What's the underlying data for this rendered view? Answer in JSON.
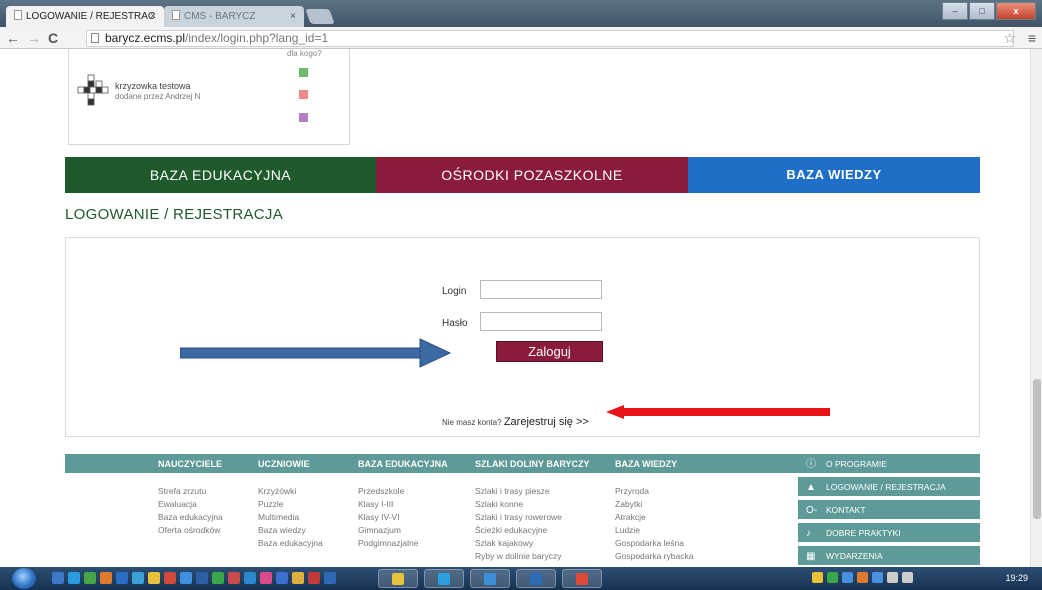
{
  "browser": {
    "tabs": [
      {
        "label": "LOGOWANIE / REJESTRAC",
        "close": "×"
      },
      {
        "label": "CMS - BARYCZ",
        "close": "×"
      }
    ],
    "window_buttons": {
      "min": "–",
      "max": "□",
      "close": "x"
    },
    "url_host": "barycz.ecms.pl",
    "url_path": "/index/login.php?lang_id=1",
    "back": "←",
    "forward": "→",
    "reload": "C",
    "star": "☆",
    "menu": "≡"
  },
  "widget": {
    "caption": "dla kogo?",
    "title": "krzyzowka testowa",
    "byline": "dodane przez Andrzej N",
    "audience_colors": [
      "#6dbb6d",
      "#ef8a8a",
      "#b07fc4"
    ]
  },
  "categories": [
    {
      "label": "Baza edukacyjna",
      "color": "#1f5a2c"
    },
    {
      "label": "Ośrodki pozaszkolne",
      "color": "#8a1b3a"
    },
    {
      "label": "BAZA WIEDZY",
      "color": "#1f6ec7"
    }
  ],
  "page_title": "LOGOWANIE / REJESTRACJA",
  "login_form": {
    "login_label": "Login",
    "password_label": "Hasło",
    "login_value": "",
    "password_value": "",
    "submit_label": "Zaloguj",
    "no_account_text": "Nie masz konta?",
    "register_link": "Zarejestruj się >>"
  },
  "footer": {
    "columns": [
      {
        "header": "NAUCZYCIELE",
        "items": [
          "Strefa zrzutu",
          "Ewaluacja",
          "Baza edukacyjna",
          "Oferta ośrodków"
        ]
      },
      {
        "header": "UCZNIOWIE",
        "items": [
          "Krzyżówki",
          "Puzzle",
          "Multimedia",
          "Baza wiedzy",
          "Baza edukacyjna"
        ]
      },
      {
        "header": "BAZA EDUKACYJNA",
        "items": [
          "Przedszkole",
          "Klasy I-III",
          "Klasy IV-VI",
          "Gimnazjum",
          "Podgimnazjalne"
        ]
      },
      {
        "header": "SZLAKI DOLINY BARYCZY",
        "items": [
          "Szlaki i trasy piesze",
          "Szlaki konne",
          "Szlaki i trasy rowerowe",
          "Ścieżki edukacyjne",
          "Szlak kajakowy",
          "Ryby w dolinie baryczy"
        ]
      },
      {
        "header": "BAZA WIEDZY",
        "items": [
          "Przyroda",
          "Zabytki",
          "Atrakcje",
          "Ludzie",
          "Gospodarka leśna",
          "Gospodarka rybacka"
        ]
      }
    ],
    "side_menu": [
      {
        "label": "O PROGRAMIE",
        "icon": "ⓘ"
      },
      {
        "label": "LOGOWANIE / REJESTRACJA",
        "icon": "▲"
      },
      {
        "label": "KONTAKT",
        "icon": "O-"
      },
      {
        "label": "DOBRE PRAKTYKI",
        "icon": "♪"
      },
      {
        "label": "WYDARZENIA",
        "icon": "▦"
      }
    ]
  },
  "taskbar": {
    "clock": "19:29",
    "pinned_colors": [
      "#3c78c8",
      "#2a9be0",
      "#46a546",
      "#e07a2c",
      "#2b6cc4",
      "#3aa0d8",
      "#e8c23a",
      "#d04b3a",
      "#4090e0",
      "#2d5fa8",
      "#3aa64a",
      "#c84a4a",
      "#2a8ad0",
      "#d84a8a",
      "#3b6fd0",
      "#e0b040",
      "#c03a3a",
      "#2c6ab8"
    ],
    "running_colors": [
      "#e8c23a",
      "#2aa0e0",
      "#3d8fd8",
      "#2c6ab8",
      "#e04a3a"
    ],
    "tray_colors": [
      "#e8c23a",
      "#3aa64a",
      "#4a90e0",
      "#e07a2c",
      "#4a90e0",
      "#cccccc",
      "#cccccc"
    ]
  }
}
